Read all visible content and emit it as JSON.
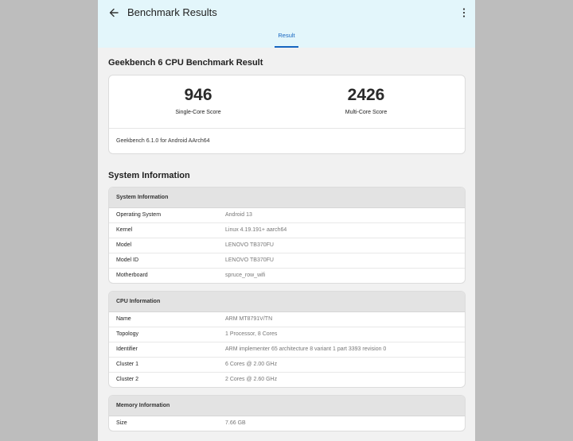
{
  "appbar": {
    "title": "Benchmark Results",
    "back_icon": "arrow-left-icon",
    "menu_icon": "more-vert-icon"
  },
  "tabs": [
    {
      "label": "Result",
      "selected": true
    }
  ],
  "result": {
    "heading": "Geekbench 6 CPU Benchmark Result",
    "single_core_score": "946",
    "single_core_label": "Single-Core Score",
    "multi_core_score": "2426",
    "multi_core_label": "Multi-Core Score",
    "version": "Geekbench 6.1.0 for Android AArch64"
  },
  "system_information": {
    "heading": "System Information",
    "sections": [
      {
        "title": "System Information",
        "rows": [
          {
            "key": "Operating System",
            "value": "Android 13"
          },
          {
            "key": "Kernel",
            "value": "Linux 4.19.191+ aarch64"
          },
          {
            "key": "Model",
            "value": "LENOVO TB370FU"
          },
          {
            "key": "Model ID",
            "value": "LENOVO TB370FU"
          },
          {
            "key": "Motherboard",
            "value": "spruce_row_wifi"
          }
        ]
      },
      {
        "title": "CPU Information",
        "rows": [
          {
            "key": "Name",
            "value": "ARM MT8791V/TN"
          },
          {
            "key": "Topology",
            "value": "1 Processor, 8 Cores"
          },
          {
            "key": "Identifier",
            "value": "ARM implementer 65 architecture 8 variant 1 part 3393 revision 0"
          },
          {
            "key": "Cluster 1",
            "value": "6 Cores @ 2.00 GHz"
          },
          {
            "key": "Cluster 2",
            "value": "2 Cores @ 2.60 GHz"
          }
        ]
      },
      {
        "title": "Memory Information",
        "rows": [
          {
            "key": "Size",
            "value": "7.66 GB"
          }
        ]
      }
    ]
  },
  "colors": {
    "accent": "#1565c0",
    "appbar_bg": "#e3f6fb",
    "page_bg": "#f1f1f1",
    "outer_bg": "#bdbdbd"
  }
}
